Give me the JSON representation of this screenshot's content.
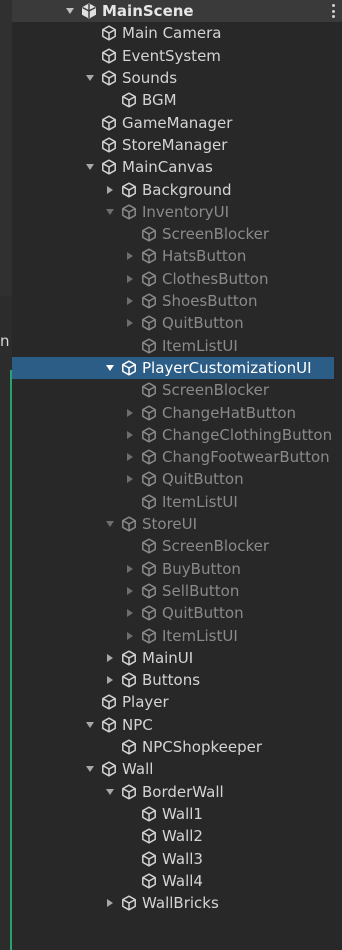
{
  "left_panel": {
    "clipped_text": "n"
  },
  "hierarchy": {
    "scene": {
      "label": "MainScene",
      "icon": "unity-scene-icon"
    },
    "items": [
      {
        "label": "Main Camera",
        "depth": 1,
        "arrow": "none",
        "state": "normal"
      },
      {
        "label": "EventSystem",
        "depth": 1,
        "arrow": "none",
        "state": "normal"
      },
      {
        "label": "Sounds",
        "depth": 1,
        "arrow": "expanded",
        "state": "normal"
      },
      {
        "label": "BGM",
        "depth": 2,
        "arrow": "none",
        "state": "normal"
      },
      {
        "label": "GameManager",
        "depth": 1,
        "arrow": "none",
        "state": "normal"
      },
      {
        "label": "StoreManager",
        "depth": 1,
        "arrow": "none",
        "state": "normal"
      },
      {
        "label": "MainCanvas",
        "depth": 1,
        "arrow": "expanded",
        "state": "normal"
      },
      {
        "label": "Background",
        "depth": 2,
        "arrow": "collapsed",
        "state": "normal"
      },
      {
        "label": "InventoryUI",
        "depth": 2,
        "arrow": "expanded",
        "state": "inactive"
      },
      {
        "label": "ScreenBlocker",
        "depth": 3,
        "arrow": "none",
        "state": "inactive"
      },
      {
        "label": "HatsButton",
        "depth": 3,
        "arrow": "collapsed",
        "state": "inactive"
      },
      {
        "label": "ClothesButton",
        "depth": 3,
        "arrow": "collapsed",
        "state": "inactive"
      },
      {
        "label": "ShoesButton",
        "depth": 3,
        "arrow": "collapsed",
        "state": "inactive"
      },
      {
        "label": "QuitButton",
        "depth": 3,
        "arrow": "collapsed",
        "state": "inactive"
      },
      {
        "label": "ItemListUI",
        "depth": 3,
        "arrow": "none",
        "state": "inactive"
      },
      {
        "label": "PlayerCustomizationUI",
        "depth": 2,
        "arrow": "expanded",
        "state": "selected"
      },
      {
        "label": "ScreenBlocker",
        "depth": 3,
        "arrow": "none",
        "state": "inactive"
      },
      {
        "label": "ChangeHatButton",
        "depth": 3,
        "arrow": "collapsed",
        "state": "inactive"
      },
      {
        "label": "ChangeClothingButton",
        "depth": 3,
        "arrow": "collapsed",
        "state": "inactive"
      },
      {
        "label": "ChangFootwearButton",
        "depth": 3,
        "arrow": "collapsed",
        "state": "inactive"
      },
      {
        "label": "QuitButton",
        "depth": 3,
        "arrow": "collapsed",
        "state": "inactive"
      },
      {
        "label": "ItemListUI",
        "depth": 3,
        "arrow": "none",
        "state": "inactive"
      },
      {
        "label": "StoreUI",
        "depth": 2,
        "arrow": "expanded",
        "state": "inactive"
      },
      {
        "label": "ScreenBlocker",
        "depth": 3,
        "arrow": "none",
        "state": "inactive"
      },
      {
        "label": "BuyButton",
        "depth": 3,
        "arrow": "collapsed",
        "state": "inactive"
      },
      {
        "label": "SellButton",
        "depth": 3,
        "arrow": "collapsed",
        "state": "inactive"
      },
      {
        "label": "QuitButton",
        "depth": 3,
        "arrow": "collapsed",
        "state": "inactive"
      },
      {
        "label": "ItemListUI",
        "depth": 3,
        "arrow": "collapsed",
        "state": "inactive"
      },
      {
        "label": "MainUI",
        "depth": 2,
        "arrow": "collapsed",
        "state": "normal"
      },
      {
        "label": "Buttons",
        "depth": 2,
        "arrow": "collapsed",
        "state": "normal"
      },
      {
        "label": "Player",
        "depth": 1,
        "arrow": "none",
        "state": "normal"
      },
      {
        "label": "NPC",
        "depth": 1,
        "arrow": "expanded",
        "state": "normal"
      },
      {
        "label": "NPCShopkeeper",
        "depth": 2,
        "arrow": "none",
        "state": "normal"
      },
      {
        "label": "Wall",
        "depth": 1,
        "arrow": "expanded",
        "state": "normal"
      },
      {
        "label": "BorderWall",
        "depth": 2,
        "arrow": "expanded",
        "state": "normal"
      },
      {
        "label": "Wall1",
        "depth": 3,
        "arrow": "none",
        "state": "normal"
      },
      {
        "label": "Wall2",
        "depth": 3,
        "arrow": "none",
        "state": "normal"
      },
      {
        "label": "Wall3",
        "depth": 3,
        "arrow": "none",
        "state": "normal"
      },
      {
        "label": "Wall4",
        "depth": 3,
        "arrow": "none",
        "state": "normal"
      },
      {
        "label": "WallBricks",
        "depth": 2,
        "arrow": "collapsed",
        "state": "normal"
      }
    ]
  },
  "colors": {
    "background": "#282828",
    "selected": "#2c5d87",
    "text": "#d4d4d4",
    "inactive_text": "#8a8a8a",
    "accent_green": "#29a36e"
  }
}
